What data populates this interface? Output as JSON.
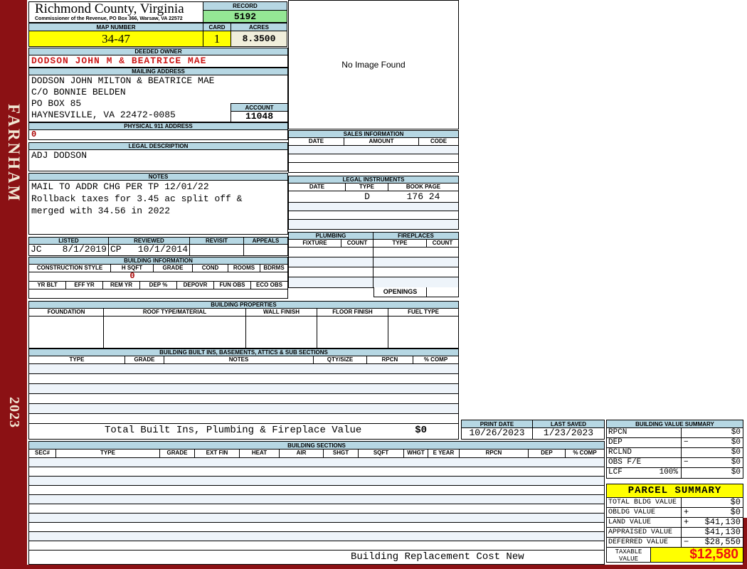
{
  "sidebar": {
    "district": "FARNHAM",
    "year": "2023"
  },
  "header": {
    "county_title": "Richmond County, Virginia",
    "county_subtitle": "Commissioner of the Revenue, PO Box 366, Warsaw, VA 22572",
    "record_label": "RECORD",
    "record_value": "5192",
    "map_number_label": "MAP NUMBER",
    "map_number_value": "34-47",
    "card_label": "CARD",
    "card_value": "1",
    "acres_label": "ACRES",
    "acres_value": "8.3500"
  },
  "owner": {
    "deeded_owner_label": "DEEDED OWNER",
    "deeded_owner_value": "DODSON JOHN M & BEATRICE MAE",
    "mailing_address_label": "MAILING ADDRESS",
    "mailing_lines": [
      "DODSON JOHN MILTON & BEATRICE MAE",
      "C/O BONNIE BELDEN",
      "PO BOX 85",
      "HAYNESVILLE, VA 22472-0085"
    ],
    "account_label": "ACCOUNT",
    "account_value": "11048",
    "physical_address_label": "PHYSICAL 911 ADDRESS",
    "physical_address_value": "0",
    "legal_description_label": "LEGAL DESCRIPTION",
    "legal_description_value": "ADJ DODSON",
    "notes_label": "NOTES",
    "notes_lines": [
      "MAIL TO ADDR CHG PER TP 12/01/22",
      "Rollback taxes for 3.45 ac split off &",
      "merged with 34.56 in 2022"
    ]
  },
  "image_box": {
    "message": "No Image Found"
  },
  "sales_information": {
    "title": "SALES INFORMATION",
    "columns": [
      "DATE",
      "AMOUNT",
      "CODE"
    ]
  },
  "legal_instruments": {
    "title": "LEGAL INSTRUMENTS",
    "columns": [
      "DATE",
      "TYPE",
      "BOOK PAGE"
    ],
    "rows": [
      {
        "date": "",
        "type": "D",
        "book_page": "176 24"
      }
    ]
  },
  "plumbing": {
    "title": "PLUMBING",
    "columns": [
      "FIXTURE",
      "COUNT"
    ]
  },
  "fireplaces": {
    "title": "FIREPLACES",
    "columns": [
      "TYPE",
      "COUNT"
    ],
    "openings_label": "OPENINGS"
  },
  "inspection": {
    "listed_label": "LISTED",
    "listed_initials": "JC",
    "listed_date": "8/1/2019",
    "reviewed_label": "REVIEWED",
    "reviewed_initials": "CP",
    "reviewed_date": "10/1/2014",
    "revisit_label": "REVISIT",
    "appeals_label": "APPEALS"
  },
  "building_information": {
    "title": "BUILDING INFORMATION",
    "row1_columns": [
      "CONSTRUCTION STYLE",
      "H SQFT",
      "GRADE",
      "COND",
      "ROOMS",
      "BDRMS"
    ],
    "h_sqft_value": "0",
    "row2_columns": [
      "YR BLT",
      "EFF YR",
      "REM YR",
      "DEP %",
      "DEPOVR",
      "FUN OBS",
      "ECO OBS"
    ]
  },
  "building_properties": {
    "title": "BUILDING PROPERTIES",
    "columns": [
      "FOUNDATION",
      "ROOF TYPE/MATERIAL",
      "WALL FINISH",
      "FLOOR FINISH",
      "FUEL TYPE"
    ]
  },
  "built_ins": {
    "title": "BUILDING BUILT INS, BASEMENTS, ATTICS & SUB SECTIONS",
    "columns": [
      "TYPE",
      "GRADE",
      "NOTES",
      "QTY/SIZE",
      "RPCN",
      "% COMP"
    ],
    "total_label": "Total Built Ins, Plumbing & Fireplace Value",
    "total_value": "$0"
  },
  "print_info": {
    "print_date_label": "PRINT DATE",
    "print_date_value": "10/26/2023",
    "last_saved_label": "LAST SAVED",
    "last_saved_value": "1/23/2023"
  },
  "building_sections": {
    "title": "BUILDING SECTIONS",
    "columns": [
      "SEC#",
      "TYPE",
      "GRADE",
      "EXT FIN",
      "HEAT",
      "AIR",
      "SHGT",
      "SQFT",
      "WHGT",
      "E YEAR",
      "RPCN",
      "DEP",
      "% COMP"
    ],
    "footer_label": "Building Replacement Cost New"
  },
  "building_value_summary": {
    "title": "BUILDING VALUE SUMMARY",
    "rows": [
      {
        "label": "RPCN",
        "op": "",
        "value": "$0"
      },
      {
        "label": "DEP",
        "op": "−",
        "value": "$0"
      },
      {
        "label": "RCLND",
        "op": "",
        "value": "$0"
      },
      {
        "label": "OBS F/E",
        "op": "−",
        "value": "$0"
      },
      {
        "label": "LCF",
        "pct": "100%",
        "op": "",
        "value": "$0"
      }
    ]
  },
  "parcel_summary": {
    "title": "PARCEL SUMMARY",
    "rows": [
      {
        "label": "TOTAL BLDG VALUE",
        "op": "",
        "value": "$0"
      },
      {
        "label": "OBLDG VALUE",
        "op": "+",
        "value": "$0"
      },
      {
        "label": "LAND VALUE",
        "op": "+",
        "value": "$41,130"
      },
      {
        "label": "APPRAISED VALUE",
        "op": "",
        "value": "$41,130"
      },
      {
        "label": "DEFERRED VALUE",
        "op": "−",
        "value": "$28,550"
      }
    ],
    "taxable_label": "TAXABLE VALUE",
    "taxable_value": "$12,580"
  },
  "colors": {
    "frame_maroon": "#8B1114",
    "label_bar_blue": "#B6D7E3",
    "record_green": "#95E795",
    "highlight_yellow": "#FFFF00",
    "acres_cream": "#F0EEDB",
    "owner_red": "#CC1A1A",
    "taxable_red": "#EE1111"
  }
}
